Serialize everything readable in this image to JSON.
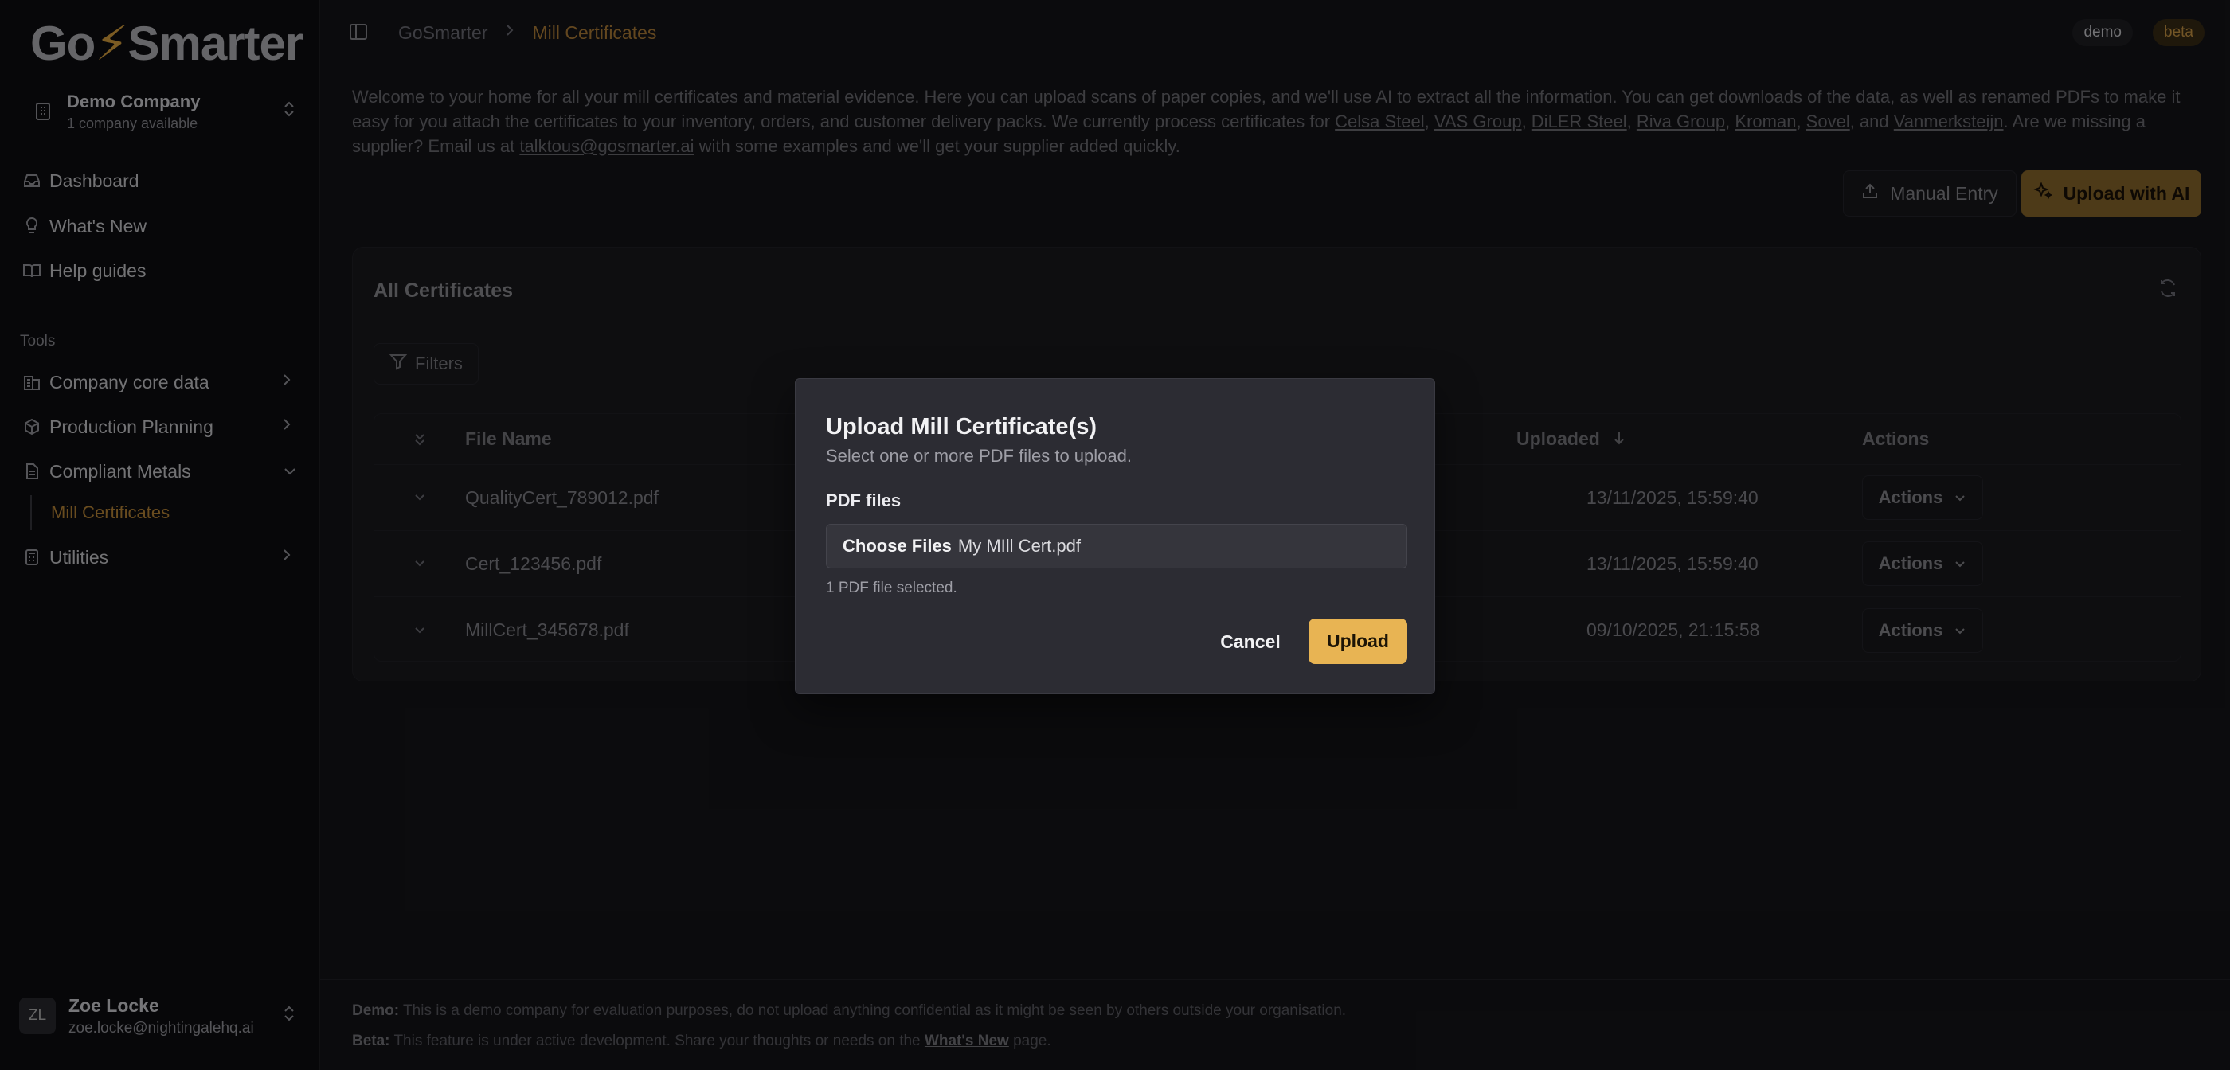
{
  "app": {
    "logo": {
      "prefix": "Go",
      "bolt": "⚡",
      "suffix": "Smarter"
    }
  },
  "company": {
    "name": "Demo Company",
    "sub": "1 company available"
  },
  "nav": {
    "dashboard": "Dashboard",
    "whats_new": "What's New",
    "help_guides": "Help guides",
    "tools_label": "Tools",
    "company_core_data": "Company core data",
    "production_planning": "Production Planning",
    "compliant_metals": "Compliant Metals",
    "mill_certificates": "Mill Certificates",
    "utilities": "Utilities"
  },
  "user": {
    "initials": "ZL",
    "name": "Zoe Locke",
    "email": "zoe.locke@nightingalehq.ai"
  },
  "breadcrumb": {
    "root": "GoSmarter",
    "current": "Mill Certificates"
  },
  "badges": {
    "demo": "demo",
    "beta": "beta"
  },
  "intro": {
    "p1": "Welcome to your home for all your mill certificates and material evidence. Here you can upload scans of paper copies, and we'll use AI to extract all the information. You can get downloads of the data, as well as renamed PDFs to make it easy for you attach the certificates to your inventory, orders, and customer delivery packs. We currently process certificates for ",
    "suppliers": [
      "Celsa Steel",
      "VAS Group",
      "DiLER Steel",
      "Riva Group",
      "Kroman",
      "Sovel",
      "Vanmerksteijn"
    ],
    "p2": ". Are we missing a supplier? Email us at ",
    "email": "talktous@gosmarter.ai",
    "p3": " with some examples and we'll get your supplier added quickly."
  },
  "actions": {
    "manual_entry": "Manual Entry",
    "upload_ai": "Upload with AI"
  },
  "card": {
    "title": "All Certificates",
    "filters": "Filters"
  },
  "table": {
    "headers": {
      "file_name": "File Name",
      "uploaded": "Uploaded",
      "actions": "Actions"
    },
    "rows": [
      {
        "file": "QualityCert_789012.pdf",
        "uploaded": "13/11/2025, 15:59:40",
        "action": "Actions"
      },
      {
        "file": "Cert_123456.pdf",
        "uploaded": "13/11/2025, 15:59:40",
        "action": "Actions"
      },
      {
        "file": "MillCert_345678.pdf",
        "uploaded": "09/10/2025, 21:15:58",
        "action": "Actions"
      }
    ]
  },
  "footer": {
    "demo_label": "Demo:",
    "demo_text": " This is a demo company for evaluation purposes, do not upload anything confidential as it might be seen by others outside your organisation.",
    "beta_label": "Beta:",
    "beta_text": " This feature is under active development. Share your thoughts or needs on the ",
    "beta_link": "What's New",
    "beta_end": " page."
  },
  "modal": {
    "title": "Upload Mill Certificate(s)",
    "subtitle": "Select one or more PDF files to upload.",
    "field_label": "PDF files",
    "choose": "Choose Files",
    "file_name": "My MIll Cert.pdf",
    "hint": "1 PDF file selected.",
    "cancel": "Cancel",
    "upload": "Upload"
  }
}
